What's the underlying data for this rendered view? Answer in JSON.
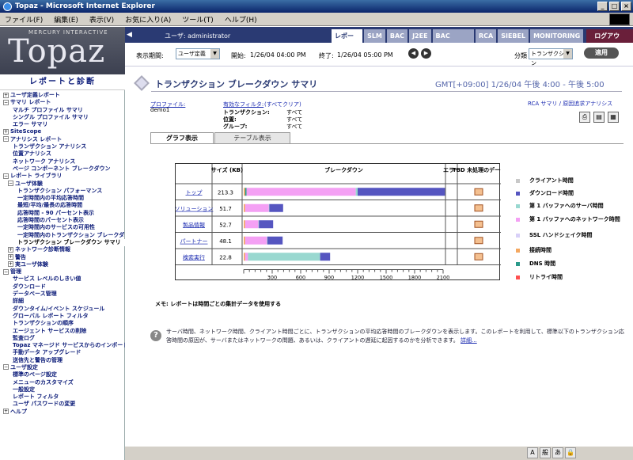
{
  "window": {
    "title": "Topaz - Microsoft Internet Explorer"
  },
  "menu": [
    "ファイル(F)",
    "編集(E)",
    "表示(V)",
    "お気に入り(A)",
    "ツール(T)",
    "ヘルプ(H)"
  ],
  "logo": {
    "vendor": "MERCURY INTERACTIVE",
    "product": "Topaz"
  },
  "sidebar": {
    "heading": "レポートと診断",
    "items": [
      {
        "t": "ユーザ定義レポート",
        "lv": 0,
        "b": "+"
      },
      {
        "t": "サマリ レポート",
        "lv": 0,
        "b": "-"
      },
      {
        "t": "マルチ プロファイル サマリ",
        "lv": 2,
        "b": ""
      },
      {
        "t": "シングル プロファイル サマリ",
        "lv": 2,
        "b": ""
      },
      {
        "t": "エラー サマリ",
        "lv": 2,
        "b": ""
      },
      {
        "t": "SiteScope",
        "lv": 0,
        "b": "+"
      },
      {
        "t": "アナリシス レポート",
        "lv": 0,
        "b": "-"
      },
      {
        "t": "トランザクション アナリシス",
        "lv": 2,
        "b": ""
      },
      {
        "t": "位置アナリシス",
        "lv": 2,
        "b": ""
      },
      {
        "t": "ネットワーク アナリシス",
        "lv": 2,
        "b": ""
      },
      {
        "t": "ページ コンポーネント ブレークダウン",
        "lv": 2,
        "b": ""
      },
      {
        "t": "レポート ライブラリ",
        "lv": 0,
        "b": "-"
      },
      {
        "t": "ユーザ体験",
        "lv": 1,
        "b": "-"
      },
      {
        "t": "トランザクション パフォーマンス",
        "lv": 3,
        "b": ""
      },
      {
        "t": "一定時間内の平均応答時間",
        "lv": 3,
        "b": ""
      },
      {
        "t": "最短/平均/最長の応答時間",
        "lv": 3,
        "b": ""
      },
      {
        "t": "応答時間 - 90 パーセント表示",
        "lv": 3,
        "b": ""
      },
      {
        "t": "応答時間のパーセント表示",
        "lv": 3,
        "b": ""
      },
      {
        "t": "一定時間内のサービスの可用性",
        "lv": 3,
        "b": ""
      },
      {
        "t": "一定時間内のトランザクション ブレークダウ",
        "lv": 3,
        "b": ""
      },
      {
        "t": "トランザクション ブレークダウン サマリ",
        "lv": 3,
        "b": "",
        "sel": true
      },
      {
        "t": "ネットワーク診断情報",
        "lv": 1,
        "b": "+"
      },
      {
        "t": "警告",
        "lv": 1,
        "b": "+"
      },
      {
        "t": "実ユーザ体験",
        "lv": 1,
        "b": "+"
      },
      {
        "t": "管理",
        "lv": 0,
        "b": "-"
      },
      {
        "t": "サービス レベルのしきい値",
        "lv": 2,
        "b": ""
      },
      {
        "t": "ダウンロード",
        "lv": 2,
        "b": ""
      },
      {
        "t": "データベース管理",
        "lv": 2,
        "b": ""
      },
      {
        "t": "詳細",
        "lv": 2,
        "b": ""
      },
      {
        "t": "ダウンタイム/イベント スケジュール",
        "lv": 2,
        "b": ""
      },
      {
        "t": "グローバル レポート フィルタ",
        "lv": 2,
        "b": ""
      },
      {
        "t": "トランザクションの順序",
        "lv": 2,
        "b": ""
      },
      {
        "t": "エージェント サービスの削除",
        "lv": 2,
        "b": ""
      },
      {
        "t": "監査ログ",
        "lv": 2,
        "b": ""
      },
      {
        "t": "Topaz マネージド サービスからのインポート",
        "lv": 2,
        "b": ""
      },
      {
        "t": "手動データ アップグレード",
        "lv": 2,
        "b": ""
      },
      {
        "t": "送信先と警告の管理",
        "lv": 2,
        "b": ""
      },
      {
        "t": "ユーザ設定",
        "lv": 0,
        "b": "-"
      },
      {
        "t": "標準のページ設定",
        "lv": 2,
        "b": ""
      },
      {
        "t": "メニューのカスタマイズ",
        "lv": 2,
        "b": ""
      },
      {
        "t": "一般設定",
        "lv": 2,
        "b": ""
      },
      {
        "t": "レポート フィルタ",
        "lv": 2,
        "b": ""
      },
      {
        "t": "ユーザ パスワードの変更",
        "lv": 2,
        "b": ""
      },
      {
        "t": "ヘルプ",
        "lv": 0,
        "b": "+"
      }
    ]
  },
  "topbar": {
    "user": "ユーザ: administrator",
    "tabs": [
      "レポート",
      "SLM",
      "BAC",
      "J2EE",
      "BAC CONF",
      "RCA",
      "SIEBEL",
      "MONITORING"
    ],
    "logout": "ログアウト"
  },
  "filter": {
    "period_label": "表示期間:",
    "period_value": "ユーザ定義",
    "start_label": "開始:",
    "start_value": "1/26/04 04:00 PM",
    "end_label": "終了:",
    "end_value": "1/26/04 05:00 PM",
    "group_label": "分類",
    "group_value": "トランザクション",
    "apply": "適用"
  },
  "header": {
    "title": "トランザクション ブレークダウン サマリ",
    "gmt": "GMT[+09:00]  1/26/04 午後 4:00 - 午後 5:00"
  },
  "info": {
    "profile_label": "プロファイル:",
    "profile_value": "demo1",
    "filters_label": "有効なフィルタ:",
    "filters_all": "(すべてクリア)",
    "rows": [
      {
        "k": "トランザクション:",
        "v": "すべて"
      },
      {
        "k": "位置:",
        "v": "すべて"
      },
      {
        "k": "グループ:",
        "v": "すべて"
      }
    ],
    "rca_links": "RCA サマリ / 原因追求アナリシス"
  },
  "view_tabs": [
    "グラフ表示",
    "テーブル表示"
  ],
  "chart_data": {
    "type": "bar",
    "headers": [
      "サイズ (KB)",
      "ブレークダウン",
      "エラー",
      "TBD 未処理のデータ"
    ],
    "categories": [
      "トップ",
      "ソリューション",
      "製品情報",
      "パートナー",
      "検索実行"
    ],
    "sizes": [
      "213.3",
      "51.7",
      "52.7",
      "48.1",
      "22.8"
    ],
    "x_ticks": [
      "300",
      "600",
      "900",
      "1200",
      "1500",
      "1800",
      "2100"
    ],
    "xlim": [
      0,
      2100
    ],
    "series": [
      {
        "name": "クライアント時間",
        "color": "#c8c8c8",
        "values": [
          0,
          0,
          0,
          0,
          0
        ]
      },
      {
        "name": "ダウンロード時間",
        "color": "#5555c0",
        "values": [
          920,
          145,
          150,
          160,
          105
        ]
      },
      {
        "name": "第 1 バッファへのサーバ時間",
        "color": "#99d8d0",
        "values": [
          20,
          5,
          5,
          5,
          760
        ]
      },
      {
        "name": "第 1 バッファへのネットワーク時間",
        "color": "#f4a0f4",
        "values": [
          1150,
          250,
          140,
          230,
          30
        ]
      },
      {
        "name": "SSL ハンドシェイク時間",
        "color": "#d8d0f8",
        "values": [
          0,
          0,
          0,
          0,
          0
        ]
      },
      {
        "name": "接続時間",
        "color": "#f4a860",
        "values": [
          15,
          15,
          15,
          15,
          15
        ]
      },
      {
        "name": "DNS 時間",
        "color": "#2a9a8a",
        "values": [
          15,
          0,
          0,
          0,
          0
        ]
      },
      {
        "name": "リトライ時間",
        "color": "#ff5050",
        "values": [
          0,
          0,
          0,
          0,
          0
        ]
      }
    ]
  },
  "note": "メモ: レポートは時間ごとの集計データを使用する",
  "help": {
    "text": "サーバ時間、ネットワーク時間、クライアント時間ごとに、トランザクションの平均応答時間のブレークダウンを表示します。このレポートを利用して、標準以下のトランザクション応答時間の原因が、サーバまたはネットワークの問題、あるいは、クライアントの遅延に起因するのかを分析できます。",
    "more": "詳細..."
  },
  "ime": [
    "A",
    "般",
    "あ",
    "🔒"
  ]
}
